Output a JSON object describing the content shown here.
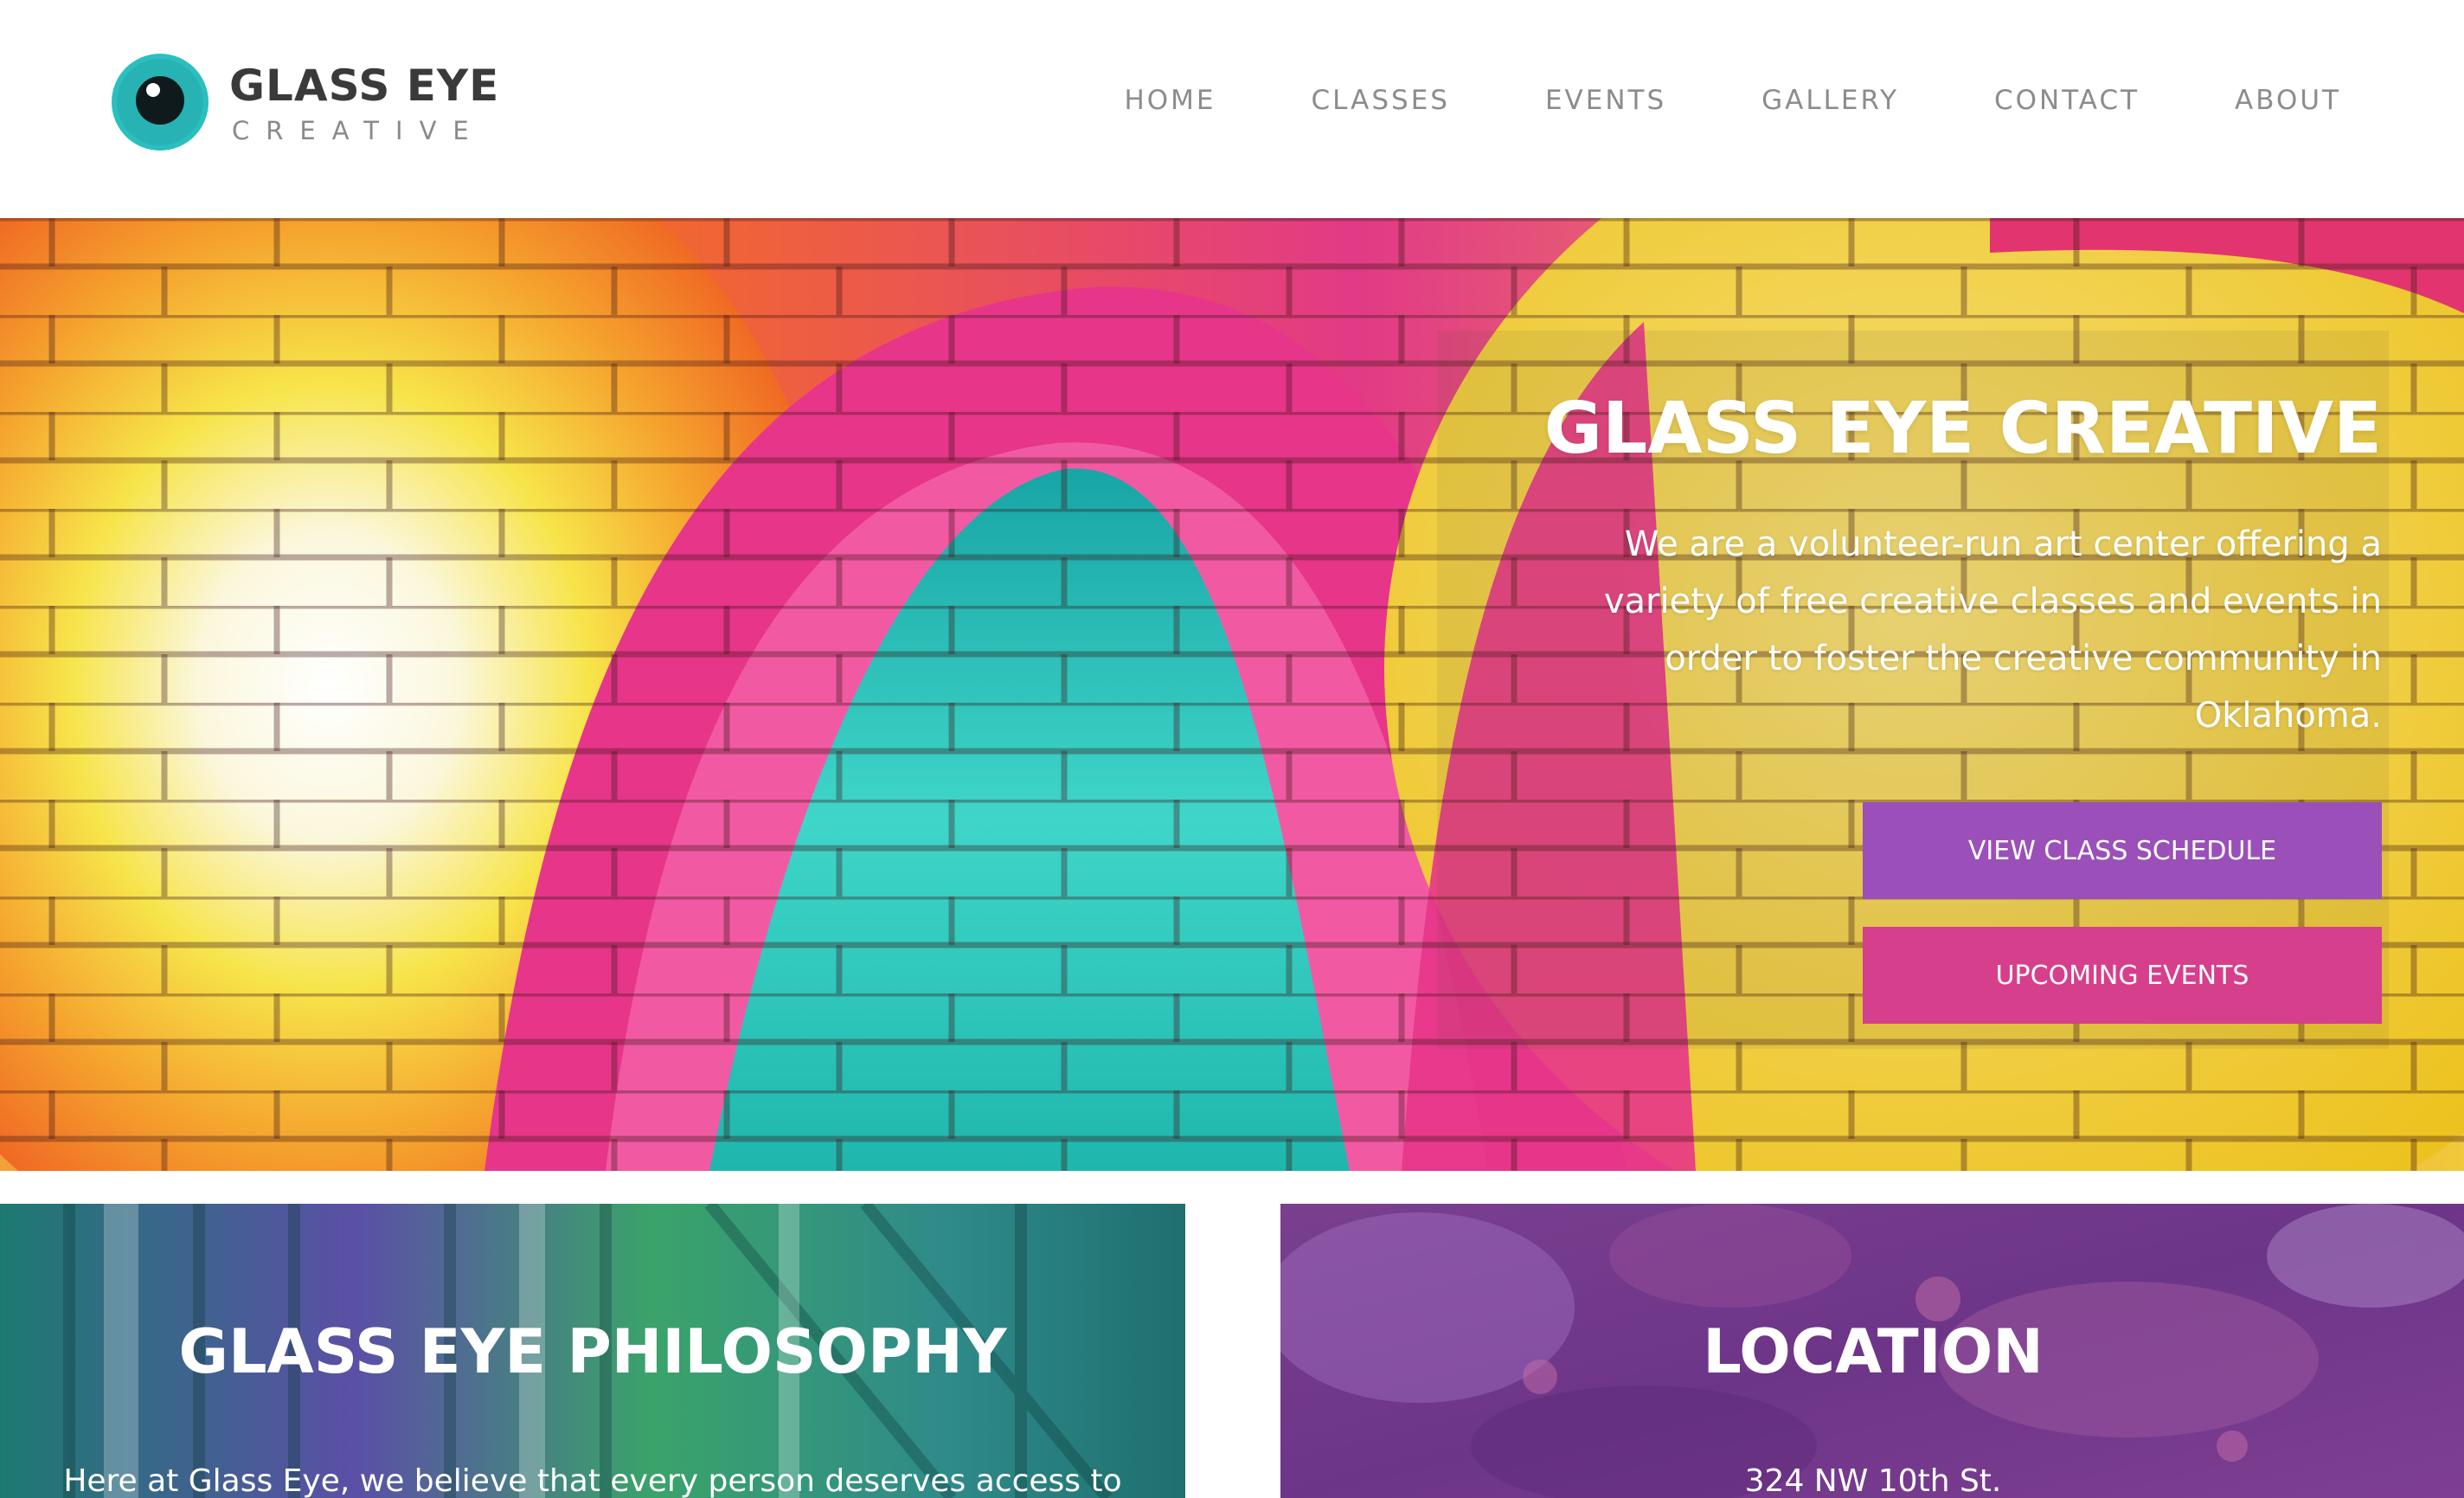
{
  "brand": {
    "name": "GLASS EYE",
    "tagline": "CREATIVE",
    "logo_icon": "eye-icon",
    "colors": {
      "teal": "#2bbfbf",
      "dark": "#3a3a3a",
      "gray": "#8a8a8a"
    }
  },
  "nav": {
    "items": [
      {
        "label": "HOME"
      },
      {
        "label": "CLASSES"
      },
      {
        "label": "EVENTS"
      },
      {
        "label": "GALLERY"
      },
      {
        "label": "CONTACT"
      },
      {
        "label": "ABOUT"
      }
    ],
    "color": "#8c8c8c"
  },
  "hero": {
    "title": "GLASS EYE CREATIVE",
    "text": "We are a volunteer-run art center offering a variety of free creative classes and events in order to foster the creative community in Oklahoma.",
    "buttons": {
      "schedule_label": "VIEW CLASS SCHEDULE",
      "events_label": "UPCOMING EVENTS"
    },
    "colors": {
      "schedule": "#9b4fb8",
      "events": "#d63f8c"
    }
  },
  "philosophy": {
    "title": "GLASS EYE PHILOSOPHY",
    "text": "Here at Glass Eye, we believe that every person deserves access to"
  },
  "location": {
    "title": "LOCATION",
    "address": "324 NW 10th St."
  }
}
